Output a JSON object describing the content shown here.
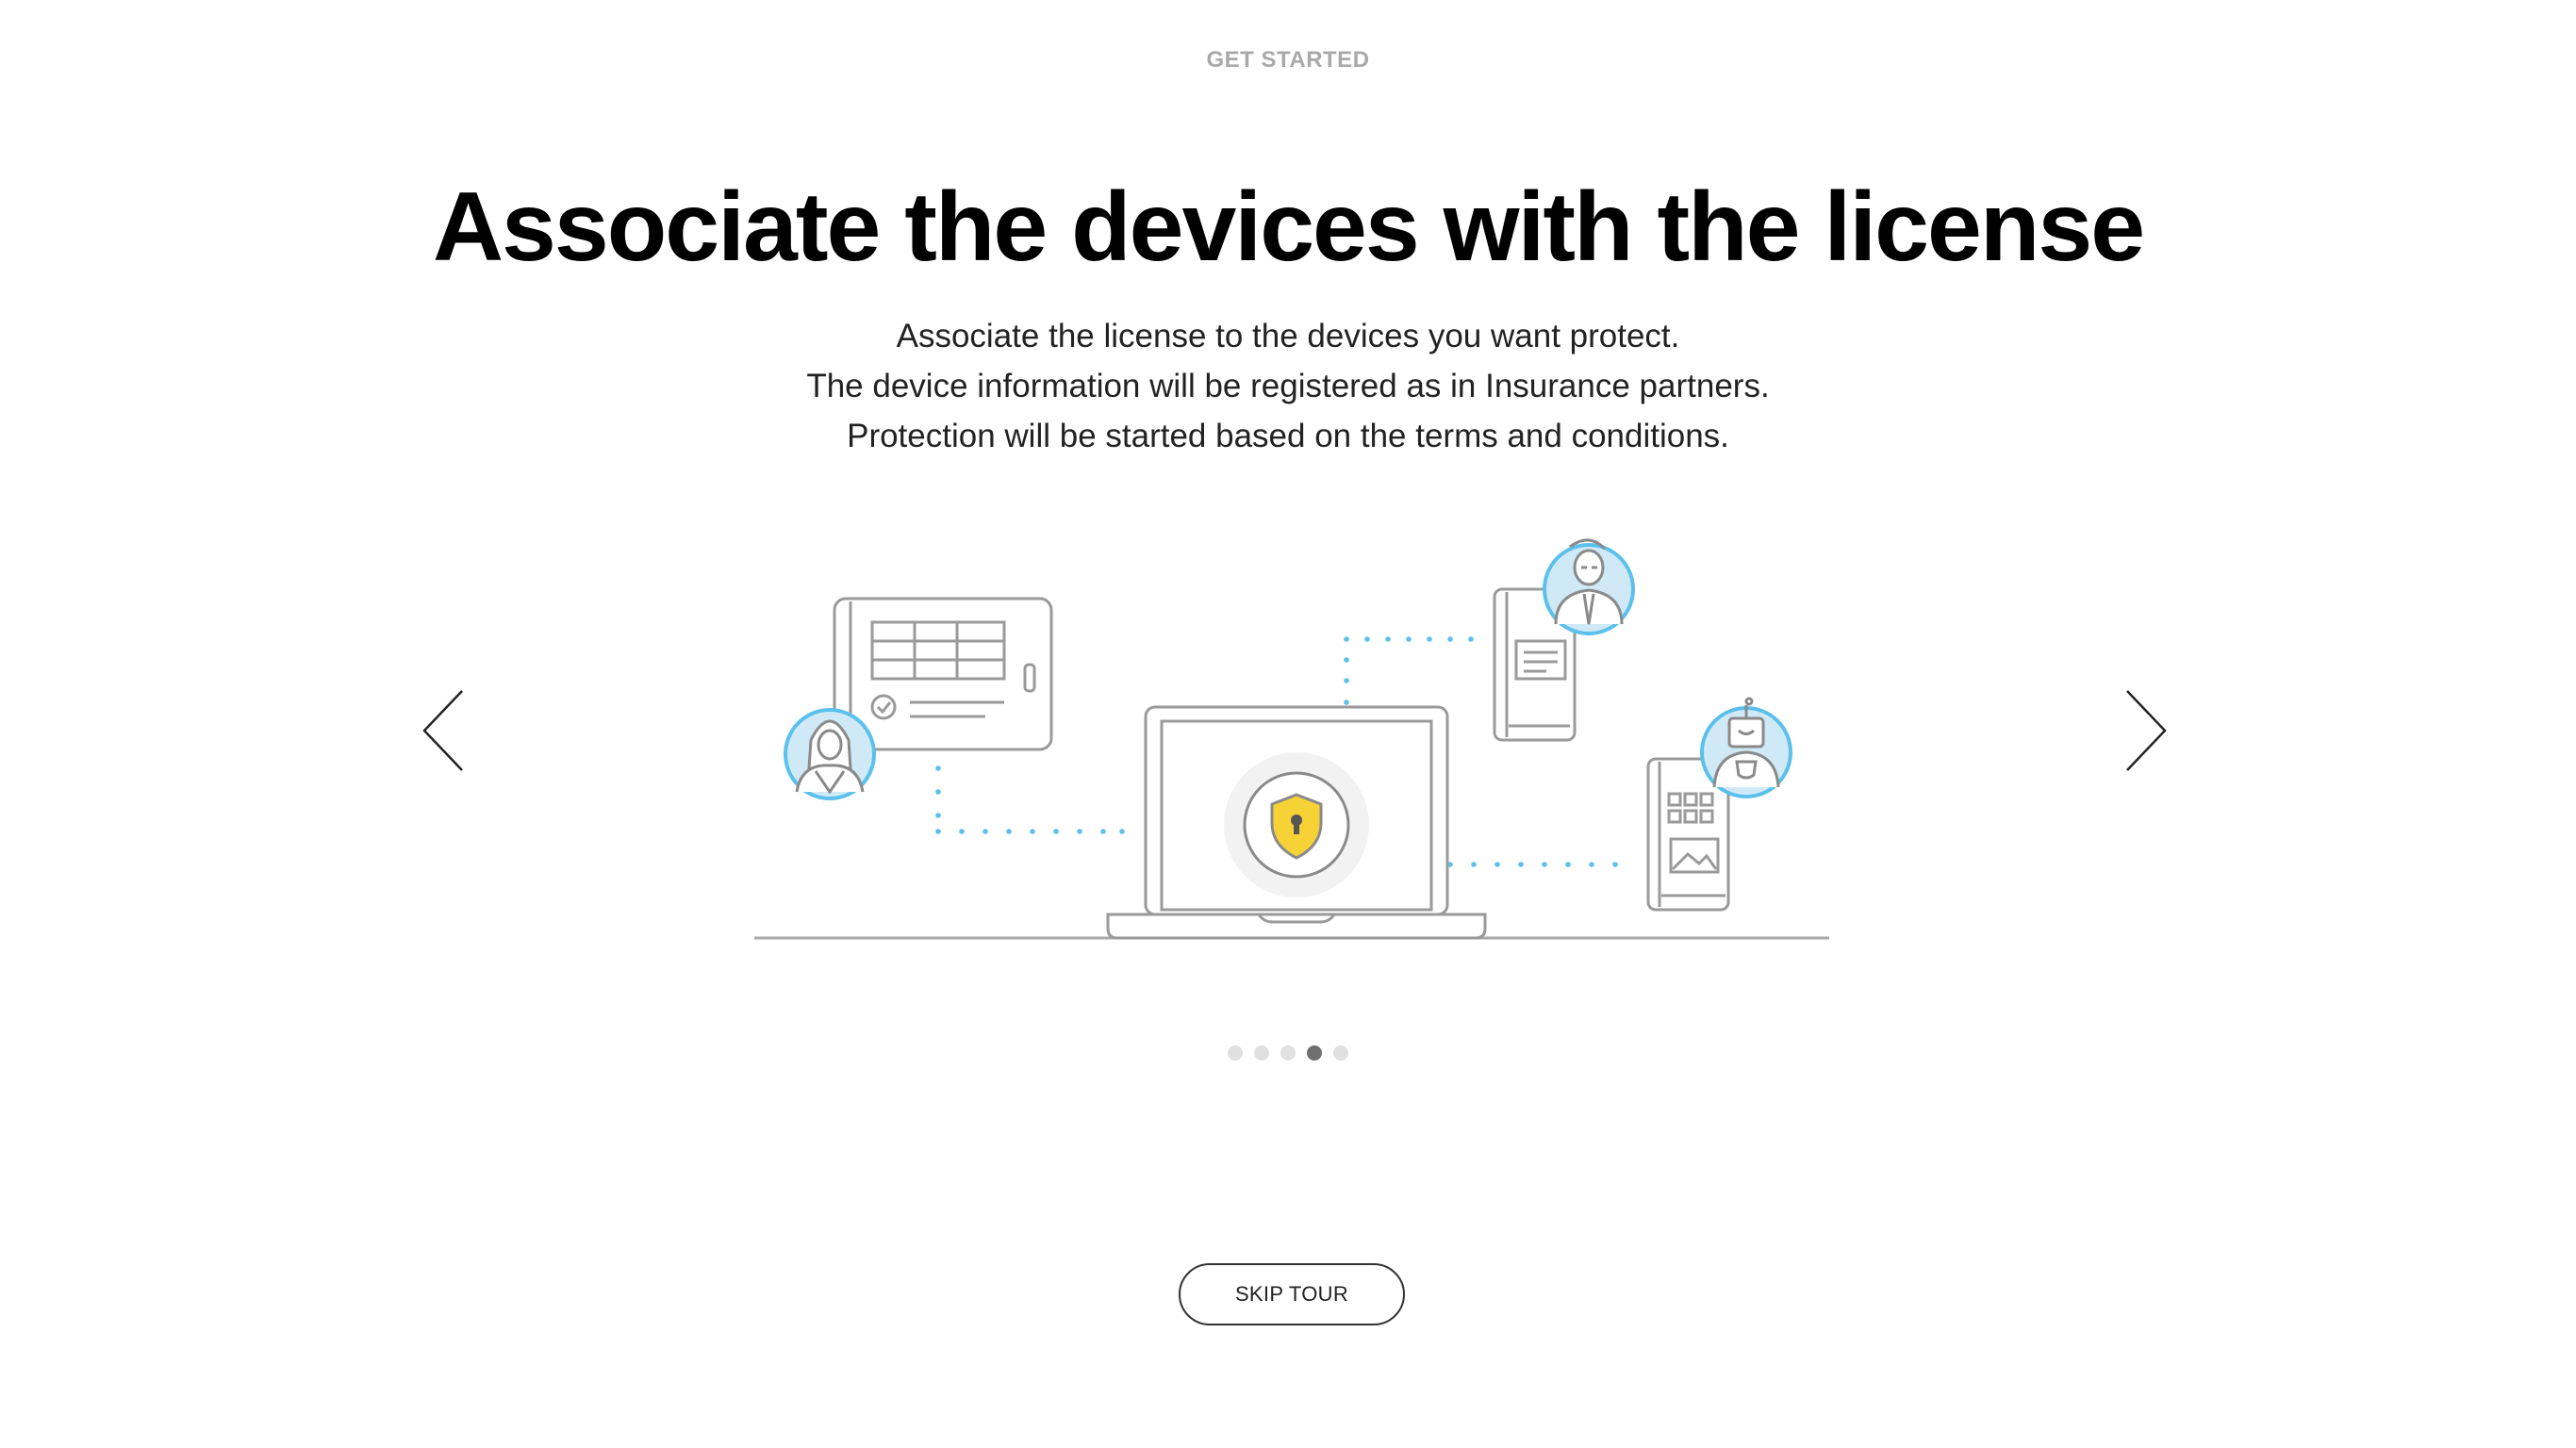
{
  "header": {
    "eyebrow": "GET STARTED",
    "title": "Associate the devices with the license"
  },
  "description": {
    "lines": [
      "Associate the license to the devices you want protect.",
      "The device information will be registered as in Insurance partners.",
      "Protection will be started based on the terms and conditions."
    ]
  },
  "navigation": {
    "prev_icon": "chevron-left-icon",
    "next_icon": "chevron-right-icon"
  },
  "pagination": {
    "total": 5,
    "current": 4
  },
  "actions": {
    "skip_label": "SKIP TOUR"
  },
  "colors": {
    "accent_blue": "#5bc0eb",
    "avatar_fill": "#cfe9f7",
    "shield_yellow": "#f7d237",
    "line_gray": "#9a9a9a"
  }
}
